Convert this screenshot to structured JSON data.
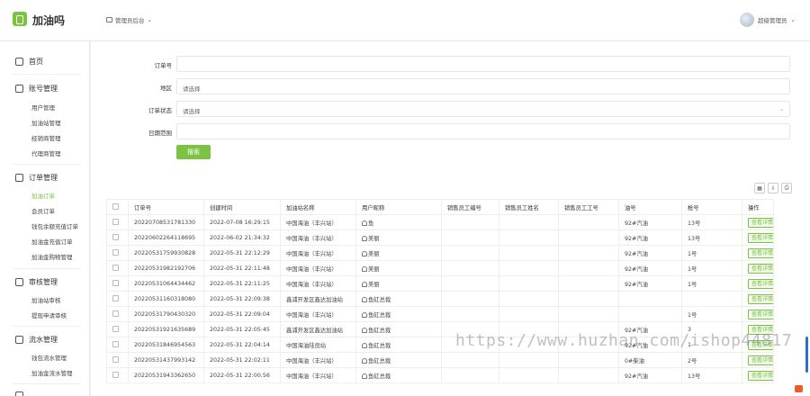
{
  "app": {
    "title": "加油吗",
    "role_switch": "管理员后台",
    "user": "超级管理员"
  },
  "sidebar": {
    "home": "首页",
    "groups": [
      {
        "label": "账号管理",
        "items": [
          "用户管理",
          "加油站管理",
          "经销商管理",
          "代理商管理"
        ]
      },
      {
        "label": "订单管理",
        "items": [
          "加油订单",
          "会员订单",
          "钱包余额充值订单",
          "加油金充值订单",
          "加油金购物管理"
        ]
      },
      {
        "label": "审核管理",
        "items": [
          "加油站审核",
          "提现申请审核"
        ]
      },
      {
        "label": "流水管理",
        "items": [
          "钱包流水管理",
          "加油金流水管理"
        ]
      },
      {
        "label": "…"
      }
    ],
    "active_item": "加油订单"
  },
  "filters": {
    "order_no": {
      "label": "订单号",
      "value": ""
    },
    "region": {
      "label": "地区",
      "placeholder": "请选择"
    },
    "status": {
      "label": "订单状态",
      "placeholder": "请选择"
    },
    "date_range": {
      "label": "日期范围",
      "value": ""
    },
    "search_label": "搜索"
  },
  "table": {
    "columns": [
      "订单号",
      "创建时间",
      "加油站名称",
      "用户昵称",
      "销售员工编号",
      "销售员工姓名",
      "销售员工工号",
      "油号",
      "枪号",
      "操作"
    ],
    "action_label": "查看详情",
    "rows": [
      [
        "20220708531781330",
        "2022-07-08 16:29:15",
        "中国海油（丰兴站）",
        "鱼",
        "",
        "",
        "",
        "92#汽油",
        "13号"
      ],
      [
        "20220602264118695",
        "2022-06-02 21:34:32",
        "中国海油（丰兴站）",
        "美丽",
        "",
        "",
        "",
        "92#汽油",
        "13号"
      ],
      [
        "20220531759930828",
        "2022-05-31 22:12:29",
        "中国海油（丰兴站）",
        "美丽",
        "",
        "",
        "",
        "92#汽油",
        "1号"
      ],
      [
        "20220531982192706",
        "2022-05-31 22:11:48",
        "中国海油（丰兴站）",
        "美丽",
        "",
        "",
        "",
        "92#汽油",
        "1号"
      ],
      [
        "20220531064434462",
        "2022-05-31 22:11:25",
        "中国海油（丰兴站）",
        "美丽",
        "",
        "",
        "",
        "92#汽油",
        "1号"
      ],
      [
        "20220531160318080",
        "2022-05-31 22:09:38",
        "鑫浦开发区鑫达加油站",
        "鱼缸总裁",
        "",
        "",
        "",
        "",
        ""
      ],
      [
        "20220531790430320",
        "2022-05-31 22:09:04",
        "中国海油（丰兴站）",
        "鱼缸总裁",
        "",
        "",
        "",
        "",
        "1号"
      ],
      [
        "20220531921635689",
        "2022-05-31 22:05:45",
        "鑫浦开发区鑫达加油站",
        "鱼缸总裁",
        "",
        "",
        "",
        "92#汽油",
        "3"
      ],
      [
        "20220531846954563",
        "2022-05-31 22:04:14",
        "中国海油陆良站",
        "鱼缸总裁",
        "",
        "",
        "",
        "92#汽油",
        "1"
      ],
      [
        "20220531437993142",
        "2022-05-31 22:02:11",
        "中国海油（丰兴站）",
        "鱼缸总裁",
        "",
        "",
        "",
        "0#柴油",
        "2号"
      ],
      [
        "20220531943362650",
        "2022-05-31 22:00:56",
        "中国海油（丰兴站）",
        "鱼缸总裁",
        "",
        "",
        "",
        "92#汽油",
        "13号"
      ]
    ]
  },
  "watermark": "https://www.huzhan.com/ishop44817",
  "colors": {
    "accent": "#7cc243",
    "scroll": "#2e6fc9"
  }
}
